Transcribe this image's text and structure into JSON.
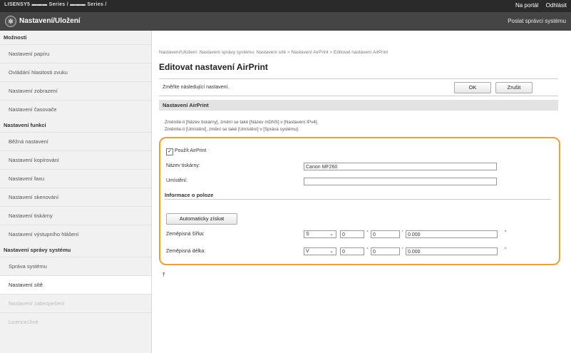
{
  "topbar": {
    "model": "LISENSY5 ▬▬▬ Series / ▬▬▬ Series /",
    "portal_link": "Na portál",
    "logout_link": "Odhlásit"
  },
  "header": {
    "logo_icon": "canon-logo-icon",
    "title": "Nastavení/Uložení",
    "send_mail_link": "Poslat správci systému"
  },
  "sidebar": {
    "sections": [
      {
        "heading": "Možnosti",
        "items": [
          {
            "label": "Nastavení papíru"
          },
          {
            "label": "Ovládání hlasitosti zvuku"
          },
          {
            "label": "Nastavení zobrazení"
          },
          {
            "label": "Nastavení časovače"
          }
        ]
      },
      {
        "heading": "Nastavení funkcí",
        "items": [
          {
            "label": "Běžná nastavení"
          },
          {
            "label": "Nastavení kopírování"
          },
          {
            "label": "Nastavení faxu"
          },
          {
            "label": "Nastavení skenování"
          },
          {
            "label": "Nastavení tiskárny"
          },
          {
            "label": "Nastavení výstupního hlášení"
          }
        ]
      },
      {
        "heading": "Nastavení správy systému",
        "items": [
          {
            "label": "Správa systému"
          },
          {
            "label": "Nastavení sítě"
          },
          {
            "label": "Nastavení zabezpečení"
          },
          {
            "label": "Licence/Jiné"
          }
        ]
      }
    ]
  },
  "main": {
    "breadcrumb": "Nastavení/Uložení: Nastavení správy systému: Nastavení sítě > Nastavení AirPrint > Editovat nastavení AirPrint",
    "page_title": "Editovat nastavení AirPrint",
    "instruction": "Změňte následující nastavení.",
    "ok_label": "OK",
    "cancel_label": "Zrušit",
    "section_title": "Nastavení AirPrint",
    "note_line1": "Změníte-li [Název tiskárny], změní se také [Název mDNS] v [Nastavení IPv4].",
    "note_line2": "Změníte-li [Umístění], změní se také [Umístění] v [Správa systému].",
    "use_airprint_label": "Použít AirPrint",
    "use_airprint_checked": true,
    "printer_name_label": "Název tiskárny:",
    "printer_name_value": "Canon MF260",
    "location_label": "Umístění:",
    "location_value": "",
    "position_heading": "Informace o poloze",
    "auto_get_label": "Automaticky získat",
    "latitude_label": "Zeměpisná šířka:",
    "latitude_dir": "S",
    "latitude_deg": "0",
    "latitude_min": "0",
    "latitude_sec": "0.000",
    "longitude_label": "Zeměpisná délka:",
    "longitude_dir": "V",
    "longitude_deg": "0",
    "longitude_min": "0",
    "longitude_sec": "0.000",
    "deg_unit": "°",
    "min_unit": "'",
    "sec_unit": "\"",
    "top_icon": "page-top-icon",
    "accent_color": "#f0a030"
  }
}
